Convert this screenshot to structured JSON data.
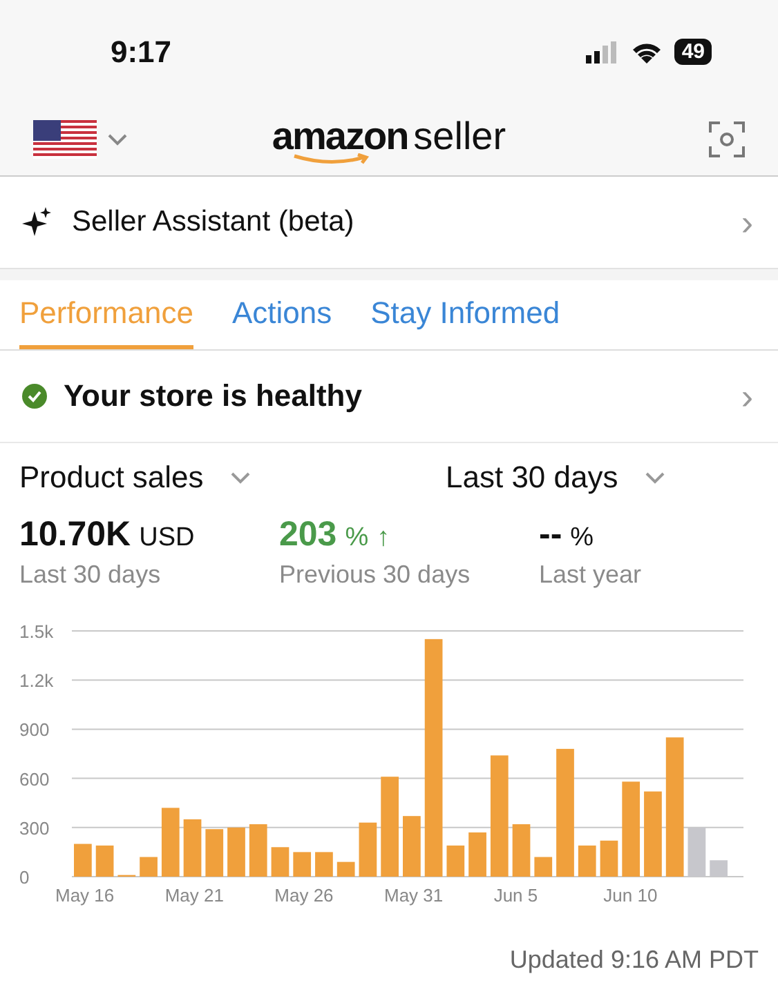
{
  "status_bar": {
    "time": "9:17",
    "battery": "49"
  },
  "header": {
    "logo_brand": "amazon",
    "logo_suffix": "seller"
  },
  "assistant": {
    "label": "Seller Assistant (beta)",
    "chevron": "›"
  },
  "tabs": [
    {
      "label": "Performance",
      "selected": true
    },
    {
      "label": "Actions",
      "selected": false
    },
    {
      "label": "Stay Informed",
      "selected": false
    }
  ],
  "health": {
    "label": "Your store is healthy",
    "chevron": "›"
  },
  "selectors": [
    {
      "label": "Product sales"
    },
    {
      "label": "Last 30 days"
    }
  ],
  "metrics": [
    {
      "kind": "amount",
      "value": "10.70K",
      "unit": "USD",
      "caption": "Last 30 days"
    },
    {
      "kind": "change",
      "value": "203",
      "unit": "%",
      "arrow": "↑",
      "caption": "Previous 30 days"
    },
    {
      "kind": "empty",
      "value": "--",
      "unit": "%",
      "caption": "Last year"
    }
  ],
  "chart": {
    "chart_data": {
      "type": "bar",
      "grid": true,
      "categories": [
        "May 16",
        null,
        null,
        null,
        null,
        "May 21",
        null,
        null,
        null,
        null,
        "May 26",
        null,
        null,
        null,
        null,
        "May 31",
        null,
        null,
        null,
        null,
        "Jun 5",
        null,
        null,
        null,
        null,
        "Jun 10",
        null,
        null,
        null,
        null
      ],
      "series": [
        {
          "color": "#f0a03c",
          "values": [
            200,
            190,
            10,
            120,
            420,
            350,
            290,
            300,
            320,
            180,
            150,
            150,
            90,
            330,
            610,
            370,
            1450,
            190,
            270,
            740,
            320,
            120,
            780,
            190,
            220,
            580,
            520,
            850,
            null,
            null
          ]
        },
        {
          "color": "#c7c7cc",
          "values": [
            null,
            null,
            null,
            null,
            null,
            null,
            null,
            null,
            null,
            null,
            null,
            null,
            null,
            null,
            null,
            null,
            null,
            null,
            null,
            null,
            null,
            null,
            null,
            null,
            null,
            null,
            null,
            null,
            300,
            100
          ]
        }
      ],
      "ylim": [
        0,
        1500
      ],
      "yticks": [
        0,
        300,
        600,
        900,
        {
          "value": 1200,
          "label": "1.2k"
        },
        {
          "value": 1500,
          "label": "1.5k"
        }
      ]
    }
  },
  "updated": "Updated 9:16 AM PDT"
}
